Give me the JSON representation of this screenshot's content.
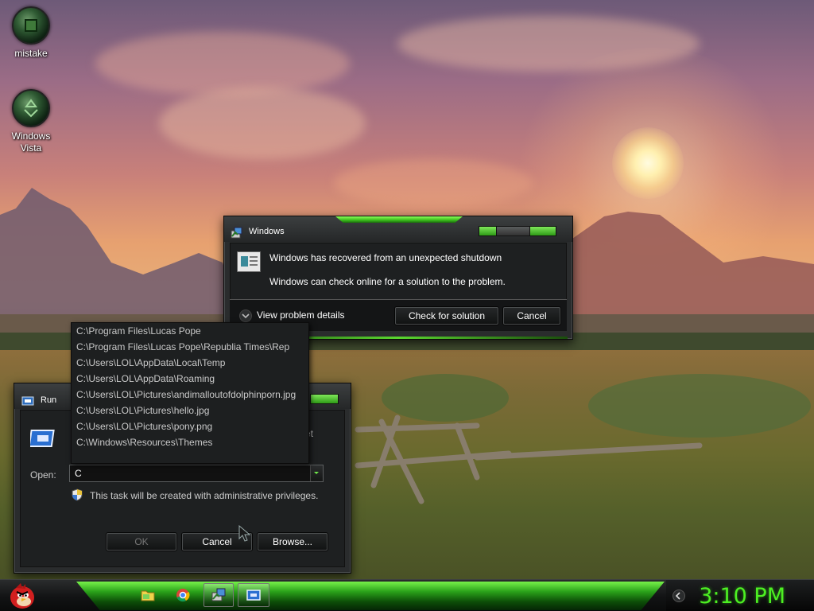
{
  "desktop": {
    "icons": [
      {
        "label": "mistake",
        "icon": "green-orb-icon"
      },
      {
        "label": "Windows Vista",
        "icon": "recycle-bin-icon"
      }
    ]
  },
  "error_dialog": {
    "title": "Windows",
    "message": "Windows has recovered from an unexpected shutdown",
    "submessage": "Windows can check online for a solution to the problem.",
    "details_label": "View problem details",
    "check_button": "Check for solution",
    "cancel_button": "Cancel"
  },
  "run_dialog": {
    "title": "Run",
    "description_fragment": "et",
    "open_label": "Open:",
    "open_value": "C",
    "admin_note": "This task will be created with administrative privileges.",
    "ok_button": "OK",
    "cancel_button": "Cancel",
    "browse_button": "Browse...",
    "suggestions": [
      "C:\\Program Files\\Lucas Pope",
      "C:\\Program Files\\Lucas Pope\\Republia Times\\Rep",
      "C:\\Users\\LOL\\AppData\\Local\\Temp",
      "C:\\Users\\LOL\\AppData\\Roaming",
      "C:\\Users\\LOL\\Pictures\\andimalloutofdolphinporn.jpg",
      "C:\\Users\\LOL\\Pictures\\hello.jpg",
      "C:\\Users\\LOL\\Pictures\\pony.png",
      "C:\\Windows\\Resources\\Themes"
    ]
  },
  "taskbar": {
    "start_icon": "angry-bird-icon",
    "items": [
      "folder-icon",
      "chrome-icon",
      "error-report-icon",
      "run-icon"
    ],
    "clock": "3:10 PM"
  },
  "colors": {
    "accent_green": "#4df022",
    "window_bg": "#2a2c2d"
  }
}
